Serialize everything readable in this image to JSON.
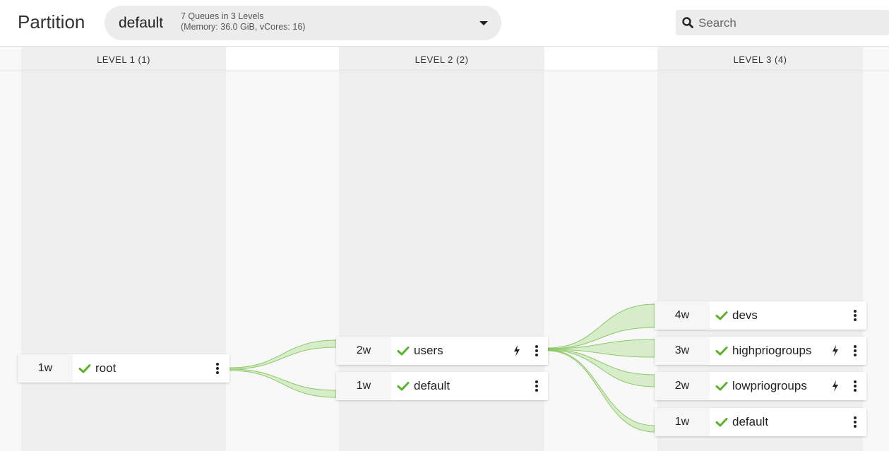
{
  "header": {
    "partition_label": "Partition",
    "partition_name": "default",
    "partition_summary_line1": "7 Queues in 3 Levels",
    "partition_summary_line2": "(Memory: 36.0 GiB, vCores: 16)",
    "search_placeholder": "Search"
  },
  "levels": [
    {
      "label": "LEVEL 1 (1)"
    },
    {
      "label": "LEVEL 2 (2)"
    },
    {
      "label": "LEVEL 3 (4)"
    }
  ],
  "queues": {
    "root": {
      "weight": "1w",
      "name": "root"
    },
    "users": {
      "weight": "2w",
      "name": "users"
    },
    "default_l2": {
      "weight": "1w",
      "name": "default"
    },
    "devs": {
      "weight": "4w",
      "name": "devs"
    },
    "highpriogroups": {
      "weight": "3w",
      "name": "highpriogroups"
    },
    "lowpriogroups": {
      "weight": "2w",
      "name": "lowpriogroups"
    },
    "default_l3": {
      "weight": "1w",
      "name": "default"
    }
  },
  "colors": {
    "check": "#5cb12d",
    "link_fill": "#d7edc9",
    "link_stroke": "#8cc866"
  }
}
